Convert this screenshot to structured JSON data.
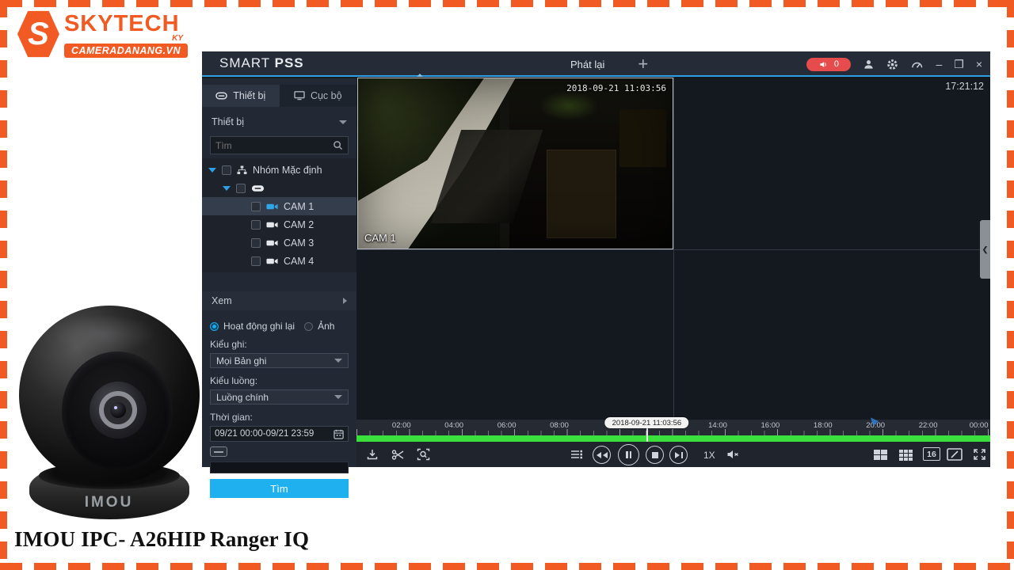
{
  "page": {
    "caption": "IMOU IPC- A26HIP Ranger IQ"
  },
  "logo": {
    "initial": "S",
    "name": "SKYTECH",
    "sub": "KY",
    "badge": "CAMERADANANG.VN"
  },
  "titlebar": {
    "brand_1": "SMART",
    "brand_2": "PSS",
    "tab_playback": "Phát lại",
    "add_tab": "+",
    "alert_count": "0",
    "clock": "17:21:12",
    "minimize": "–",
    "maximize": "❐",
    "close": "×"
  },
  "sidebar": {
    "tab_device": "Thiết bị",
    "tab_local": "Cục bộ",
    "device_dropdown": "Thiết bị",
    "search_placeholder": "Tìm",
    "tree": {
      "group": "Nhóm Mặc định",
      "cams": [
        "CAM 1",
        "CAM 2",
        "CAM 3",
        "CAM 4"
      ]
    },
    "view_label": "Xem",
    "radio_record": "Hoạt động ghi lại",
    "radio_image": "Ảnh",
    "record_type_label": "Kiểu ghi:",
    "record_type_value": "Mọi Bản ghi",
    "stream_type_label": "Kiểu luồng:",
    "stream_type_value": "Luồng chính",
    "time_label": "Thời gian:",
    "time_value": "09/21 00:00-09/21 23:59",
    "search_button": "Tìm"
  },
  "video": {
    "cam_label": "CAM 1",
    "osd_timestamp": "2018-09-21 11:03:56"
  },
  "timeline": {
    "labels": [
      "02:00",
      "04:00",
      "06:00",
      "08:00",
      "14:00",
      "16:00",
      "18:00",
      "20:00",
      "22:00",
      "00:00"
    ],
    "current_time": "2018-09-21 11:03:56"
  },
  "toolbar": {
    "speed": "1X",
    "split_16": "16"
  },
  "product": {
    "brand": "IMOU"
  },
  "colors": {
    "accent_orange": "#f15a22",
    "accent_blue": "#2e9fe6",
    "button_cyan": "#1fb0f0",
    "timeline_green": "#3ce03c",
    "alert_red": "#e64c4c",
    "selected_row": "#343d4c"
  }
}
